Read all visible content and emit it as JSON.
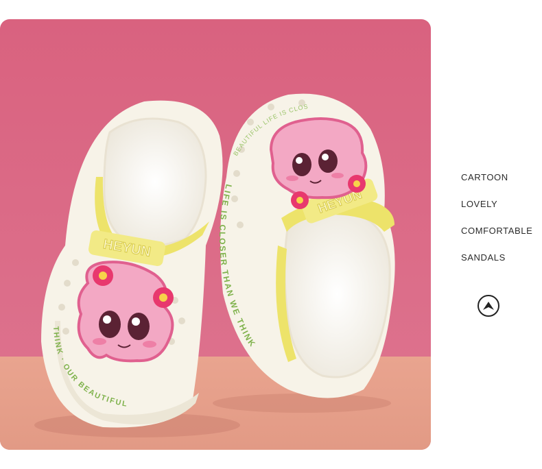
{
  "features": [
    "CARTOON",
    "LOVELY",
    "COMFORTABLE",
    "SANDALS"
  ],
  "photo": {
    "brand_text": "HEYUN",
    "strap_text": "HEYUN",
    "sole_text_left": "THINK · OUR BEAUTIFUL",
    "sole_text_right": "LIFE IS CLOSER THAN WE THINK",
    "sole_text_back": "BEAUTIFUL LIFE IS CLOSER",
    "colors": {
      "backdrop": "#db6a86",
      "floor": "#e7a28c",
      "sandal": "#f7f4ea",
      "strap": "#ede36a",
      "charm_pink": "#e86c98",
      "flower": "#e8386e",
      "sole_text": "#7fb24c"
    }
  },
  "icons": {
    "nav": "up-arrow-circle-icon"
  }
}
